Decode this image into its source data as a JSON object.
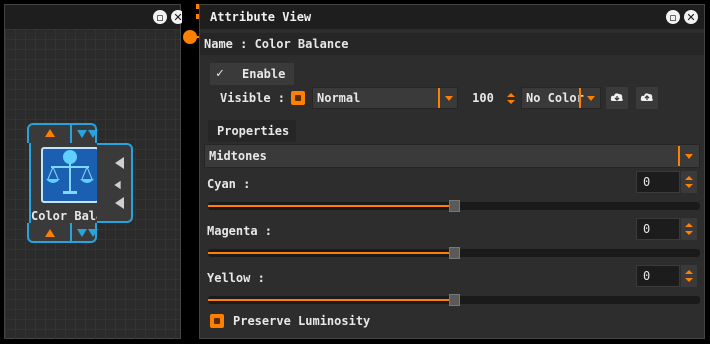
{
  "node_graph": {
    "node_label": "Color Balan"
  },
  "attribute_view": {
    "title": "Attribute View",
    "name_row": {
      "label": "Name : Color Balance"
    },
    "enable": {
      "check": "✓",
      "label": "Enable"
    },
    "visible": {
      "label": "Visible :",
      "blend_mode": "Normal",
      "opacity": "100",
      "color": "No Color"
    },
    "properties_tab": "Properties",
    "tone_range": "Midtones",
    "sliders": [
      {
        "label": "Cyan :",
        "value": "0",
        "position": 0.5
      },
      {
        "label": "Magenta :",
        "value": "0",
        "position": 0.5
      },
      {
        "label": "Yellow :",
        "value": "0",
        "position": 0.5
      }
    ],
    "preserve_luminosity": {
      "label": "Preserve Luminosity",
      "checked": true
    }
  },
  "colors": {
    "accent": "#ff7f00",
    "node_border": "#27a4de"
  },
  "icons": {
    "minimize": "minimize-icon",
    "close": "close-icon",
    "cloud_down": "cloud-download-icon",
    "cloud_up": "cloud-upload-icon"
  }
}
